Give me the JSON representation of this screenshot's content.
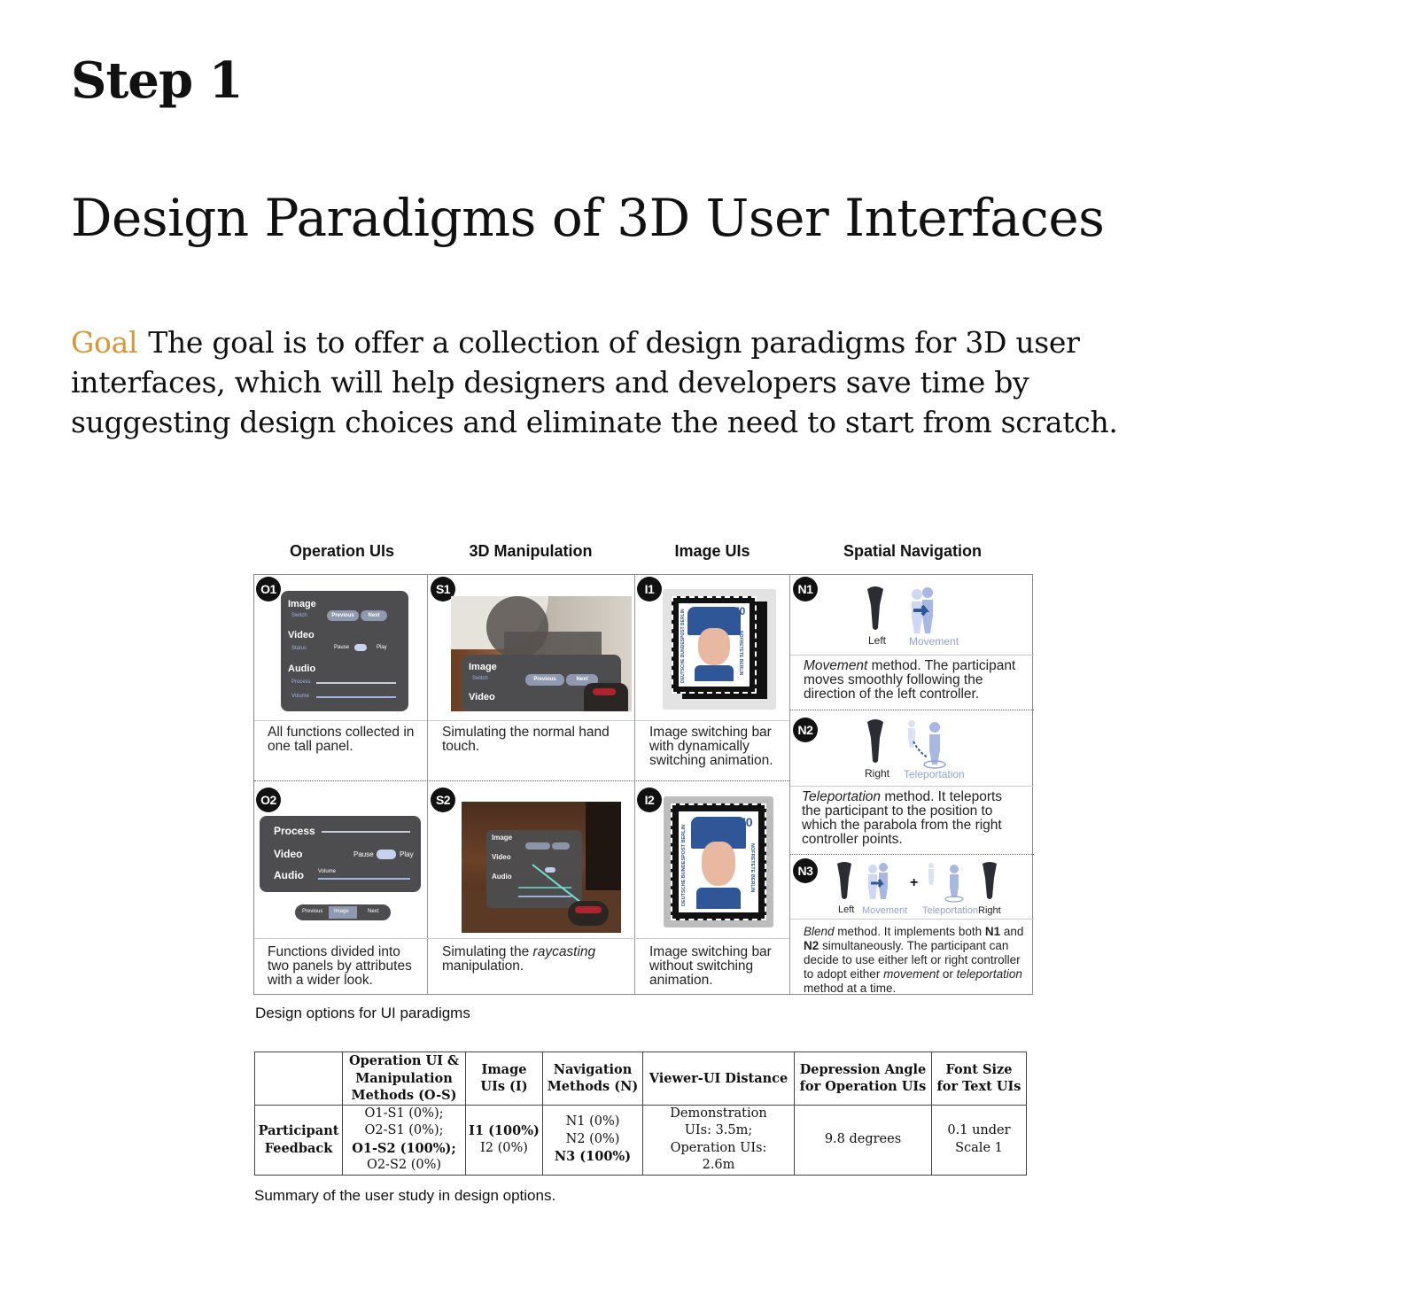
{
  "step_label": "Step 1",
  "page_title": "Design Paradigms of 3D User Interfaces",
  "goal": {
    "label": "Goal",
    "text": "The goal is to offer a collection of design paradigms for 3D user interfaces, which will help designers and developers save time by suggesting design choices and eliminate the need to start from scratch."
  },
  "figure": {
    "column_headers": [
      "Operation UIs",
      "3D Manipulation",
      "Image UIs",
      "Spatial Navigation"
    ],
    "cells": {
      "o1": {
        "badge": "O1",
        "caption": "All functions collected in one tall panel."
      },
      "o2": {
        "badge": "O2",
        "caption": "Functions divided into two panels by attributes with a wider look."
      },
      "s1": {
        "badge": "S1",
        "caption": "Simulating the normal hand touch."
      },
      "s2": {
        "badge": "S2",
        "caption_pre": "Simulating the ",
        "caption_em": "raycasting",
        "caption_post": " manipulation."
      },
      "i1": {
        "badge": "I1",
        "caption": "Image switching bar with dynamically switching animation."
      },
      "i2": {
        "badge": "I2",
        "caption": "Image switching bar without switching animation."
      },
      "n1": {
        "badge": "N1",
        "caption_em": "Movement",
        "caption_post": " method. The participant moves smoothly following the direction of the left controller.",
        "icon_labels": [
          "Left",
          "Movement"
        ]
      },
      "n2": {
        "badge": "N2",
        "caption_em": "Teleportation",
        "caption_post": " method. It teleports the participant to the position to which the parabola from the right controller points.",
        "icon_labels": [
          "Right",
          "Teleportation"
        ]
      },
      "n3": {
        "badge": "N3",
        "caption_em": "Blend",
        "caption_a": " method. It implements both ",
        "caption_b1": "N1",
        "caption_c": " and ",
        "caption_b2": "N2",
        "caption_d": " simultaneously. The participant can decide to use either left or right controller to adopt either ",
        "caption_em2": "movement",
        "caption_e": " or ",
        "caption_em3": "teleportation",
        "caption_f": " method at a time.",
        "icon_labels": [
          "Left",
          "Movement",
          "+",
          "Teleportation",
          "Right"
        ]
      }
    },
    "panel_text": {
      "o1": {
        "image": "Image",
        "switch": "Switch",
        "previous": "Previous",
        "next": "Next",
        "video": "Video",
        "status": "Status",
        "pause": "Pause",
        "play": "Play",
        "audio": "Audio",
        "process": "Process",
        "volume": "Volume"
      },
      "o2": {
        "process": "Process",
        "video": "Video",
        "pause": "Pause",
        "play": "Play",
        "audio": "Audio",
        "volume": "Volume",
        "previous": "Previous",
        "image": "Image",
        "next": "Next"
      },
      "s1": {
        "image": "Image",
        "switch": "Switch",
        "previous": "Previous",
        "next": "Next",
        "video": "Video"
      },
      "s2": {
        "image": "Image",
        "video": "Video",
        "audio": "Audio"
      },
      "stamp": {
        "value": "70",
        "left_text": "DEUTSCHE BUNDESPOST BERLIN",
        "right_text": "NOFRETETE BERLIN"
      }
    },
    "caption": "Design options for UI paradigms"
  },
  "summary_table": {
    "headers": [
      "",
      "Operation UI & Manipulation Methods (O-S)",
      "Image UIs (I)",
      "Navigation Methods (N)",
      "Viewer-UI Distance",
      "Depression Angle for Operation UIs",
      "Font Size for Text UIs"
    ],
    "row_label": "Participant Feedback",
    "os_lines": [
      "O1-S1 (0%);",
      "O2-S1 (0%);",
      "O1-S2 (100%);",
      "O2-S2 (0%)"
    ],
    "i_lines": [
      "I1 (100%)",
      "I2 (0%)"
    ],
    "n_lines": [
      "N1 (0%)",
      "N2 (0%)",
      "N3 (100%)"
    ],
    "distance": "Demonstration UIs: 3.5m; Operation UIs: 2.6m",
    "angle": "9.8 degrees",
    "font_size": "0.1 under Scale 1",
    "caption": "Summary of the user study in design options."
  },
  "colors": {
    "goal_accent": "#d99537",
    "panel_bg": "#4d4d4f",
    "nav_icon": "#a9b8e3"
  }
}
